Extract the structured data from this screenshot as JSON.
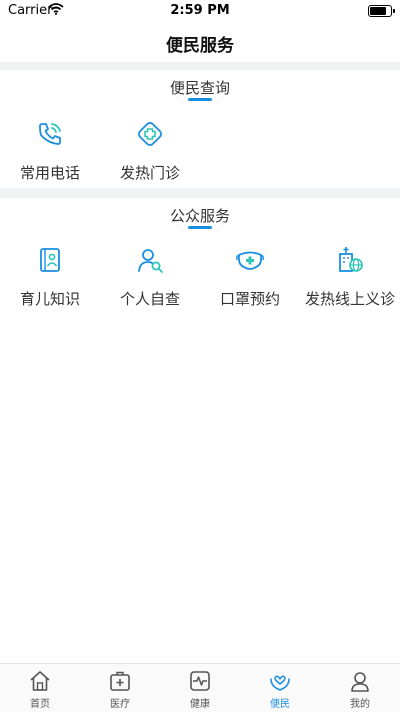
{
  "status_bar": {
    "carrier": "Carrier",
    "time": "2:59 PM",
    "battery_percent": 90
  },
  "nav": {
    "title": "便民服务"
  },
  "sections": [
    {
      "title": "便民查询",
      "items": [
        {
          "label": "常用电话",
          "icon": "phone-icon"
        },
        {
          "label": "发热门诊",
          "icon": "medical-cross-icon"
        }
      ]
    },
    {
      "title": "公众服务",
      "items": [
        {
          "label": "育儿知识",
          "icon": "parenting-book-icon"
        },
        {
          "label": "个人自查",
          "icon": "self-check-icon"
        },
        {
          "label": "口罩预约",
          "icon": "mask-icon"
        },
        {
          "label": "发热线上义诊",
          "icon": "hospital-globe-icon"
        }
      ]
    }
  ],
  "tab_bar": {
    "active": "便民",
    "tabs": [
      {
        "label": "首页",
        "icon": "home-icon"
      },
      {
        "label": "医疗",
        "icon": "medical-kit-icon"
      },
      {
        "label": "健康",
        "icon": "heartbeat-icon"
      },
      {
        "label": "便民",
        "icon": "heart-hands-icon"
      },
      {
        "label": "我的",
        "icon": "user-icon"
      }
    ]
  },
  "colors": {
    "accent": "#1a8fe0",
    "teal": "#2bc4b6",
    "tab_gray": "#555555"
  }
}
